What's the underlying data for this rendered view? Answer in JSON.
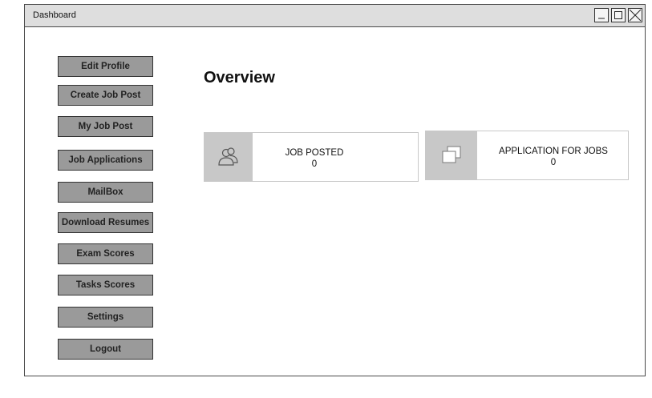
{
  "window": {
    "title": "Dashboard"
  },
  "sidebar": {
    "items": [
      {
        "label": "Edit Profile"
      },
      {
        "label": "Create Job Post"
      },
      {
        "label": "My Job Post"
      },
      {
        "label": "Job Applications"
      },
      {
        "label": "MailBox"
      },
      {
        "label": "Download Resumes"
      },
      {
        "label": "Exam Scores"
      },
      {
        "label": "Tasks Scores"
      },
      {
        "label": "Settings"
      },
      {
        "label": "Logout"
      }
    ]
  },
  "main": {
    "title": "Overview",
    "cards": [
      {
        "label": "JOB POSTED",
        "value": "0",
        "icon": "users-icon"
      },
      {
        "label": "APPLICATION FOR JOBS",
        "value": "0",
        "icon": "copy-icon"
      }
    ]
  }
}
